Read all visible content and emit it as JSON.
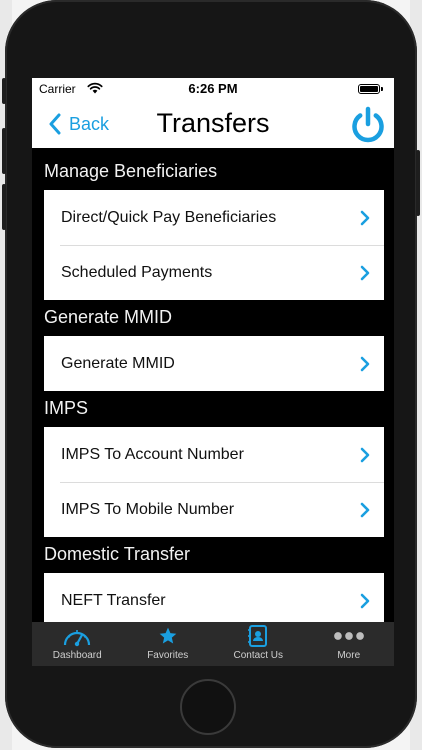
{
  "status": {
    "carrier": "Carrier",
    "time": "6:26 PM"
  },
  "nav": {
    "back_label": "Back",
    "title": "Transfers"
  },
  "colors": {
    "accent": "#1a9fe0",
    "section_bg": "#000000",
    "row_bg": "#ffffff",
    "tabbar_bg": "#2b2b2b"
  },
  "sections": [
    {
      "title": "Manage Beneficiaries",
      "items": [
        {
          "label": "Direct/Quick Pay Beneficiaries"
        },
        {
          "label": "Scheduled Payments"
        }
      ]
    },
    {
      "title": "Generate MMID",
      "items": [
        {
          "label": "Generate MMID"
        }
      ]
    },
    {
      "title": "IMPS",
      "items": [
        {
          "label": "IMPS To Account Number"
        },
        {
          "label": "IMPS To Mobile Number"
        }
      ]
    },
    {
      "title": "Domestic Transfer",
      "items": [
        {
          "label": "NEFT Transfer"
        }
      ]
    }
  ],
  "tabbar": {
    "items": [
      {
        "label": "Dashboard",
        "icon": "speedometer-icon"
      },
      {
        "label": "Favorites",
        "icon": "star-icon"
      },
      {
        "label": "Contact Us",
        "icon": "contact-book-icon"
      },
      {
        "label": "More",
        "icon": "more-dots-icon"
      }
    ]
  }
}
